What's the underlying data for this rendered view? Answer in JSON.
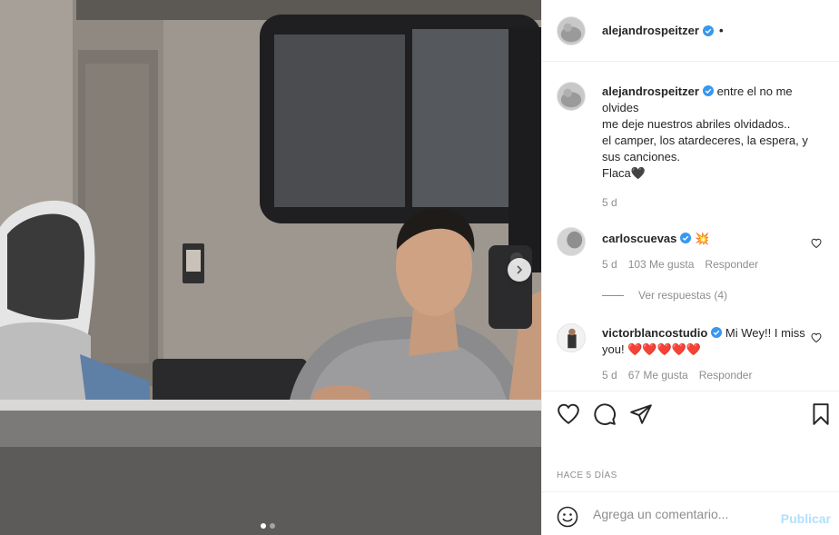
{
  "post": {
    "username": "alejandrospeitzer",
    "header_separator": "•",
    "caption": {
      "username": "alejandrospeitzer",
      "lines": [
        "entre el no me olvides",
        "me deje nuestros abriles olvidados..",
        "el camper, los atardeceres, la espera, y sus canciones.",
        "Flaca🖤"
      ],
      "time": "5 d"
    },
    "comments": [
      {
        "username": "carloscuevas",
        "text": "💥",
        "time": "5 d",
        "likes": "103 Me gusta",
        "reply_label": "Responder",
        "view_replies": "Ver respuestas (4)"
      },
      {
        "username": "victorblancostudio",
        "text": "Mi Wey!! I miss you! ❤️❤️❤️❤️❤️",
        "time": "5 d",
        "likes": "67 Me gusta",
        "reply_label": "Responder"
      }
    ],
    "date_label": "HACE 5 DÍAS",
    "composer": {
      "placeholder": "Agrega un comentario...",
      "publish_label": "Publicar"
    },
    "carousel": {
      "count": 2,
      "active_index": 0
    }
  },
  "icons": {
    "verified": "verified-badge-icon",
    "like": "heart-icon",
    "comment": "comment-bubble-icon",
    "share": "paper-plane-icon",
    "save": "bookmark-icon",
    "emoji": "smiley-icon",
    "next": "chevron-right-icon"
  },
  "colors": {
    "verified_blue": "#3897f0",
    "text": "#262626",
    "muted": "#8e8e8e",
    "publish_disabled": "#b2dffc",
    "heart_red": "#ed4956"
  }
}
